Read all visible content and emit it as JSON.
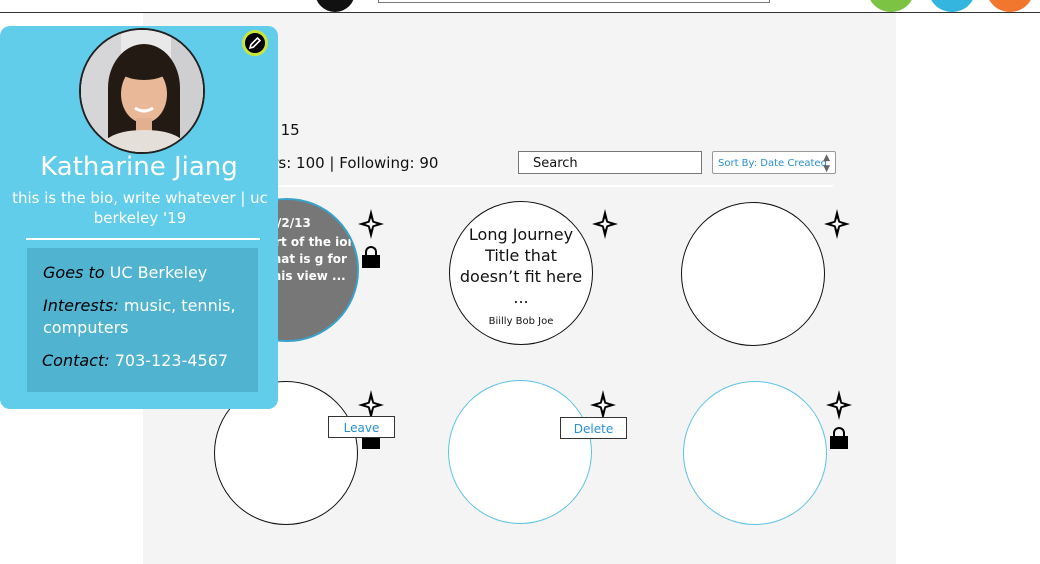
{
  "stats": {
    "views": "s: 15",
    "follow": "ers: 100 | Following: 90"
  },
  "search": {
    "label": "Search"
  },
  "sort": {
    "label": "Sort By: Date Created"
  },
  "journeys": [
    {
      "date": "/2/13",
      "description": "art of the ion that is g for this view ..."
    },
    {
      "title": "Long Journey Title that doesn’t fit here ...",
      "author": "Biilly Bob Joe"
    }
  ],
  "buttons": {
    "leave": "Leave",
    "delete": "Delete"
  },
  "profile": {
    "name": "Katharine Jiang",
    "bio": "this is the bio, write whatever | uc berkeley '19",
    "goes_to_label": "Goes to",
    "goes_to_value": "UC Berkeley",
    "interests_label": "Interests:",
    "interests_value": "music, tennis, computers",
    "contact_label": "Contact:",
    "contact_value": "703-123-4567"
  },
  "icons": [
    "compass-star-icon",
    "lock-icon",
    "pencil-icon",
    "avatar"
  ],
  "colors": {
    "profile_card": "#62cceb",
    "info_box": "#50b4d1",
    "accent_link": "#2a8fcf",
    "edit_ring": "#c8e63a",
    "top_green": "#7cc243",
    "top_blue": "#33b5df",
    "top_orange": "#f2762e"
  }
}
